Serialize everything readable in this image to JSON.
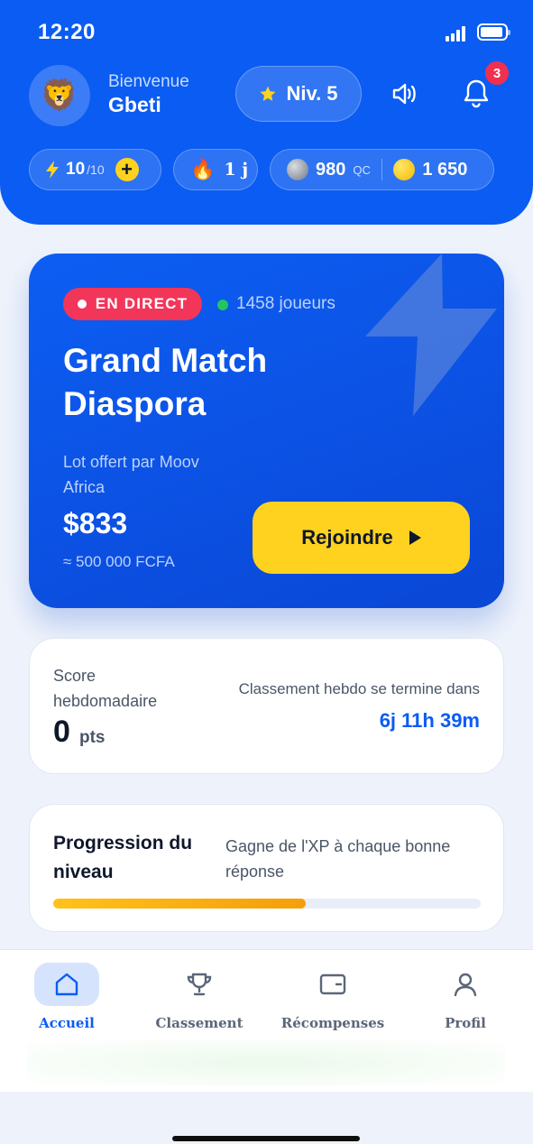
{
  "status_bar": {
    "time": "12:20"
  },
  "header": {
    "welcome": "Bienvenue",
    "username": "Gbeti",
    "avatar_emoji": "🦁",
    "level_label": "Niv. 5",
    "notifications_count": "3",
    "energy": {
      "value": "10",
      "max": "/10"
    },
    "streak": {
      "icon": "🔥",
      "value": "1 j"
    },
    "qc": {
      "value": "980",
      "unit": "QC"
    },
    "coins": {
      "value": "1 650"
    }
  },
  "live_card": {
    "badge": "EN DIRECT",
    "players": "1458  joueurs",
    "title": "Grand Match Diaspora",
    "sponsor": "Lot offert par Moov Africa",
    "prize": "$833",
    "prize_fcfa": "≈ 500 000 FCFA",
    "join_label": "Rejoindre"
  },
  "weekly": {
    "label": "Score hebdomadaire",
    "score": "0",
    "unit": "pts",
    "ends_label": "Classement hebdo se termine dans",
    "ends_value": "6j 11h 39m"
  },
  "progression": {
    "title": "Progression du niveau",
    "subtitle": "Gagne de l'XP à chaque bonne réponse",
    "fraction": 0.59
  },
  "nav": {
    "items": [
      {
        "label": "Accueil",
        "icon": "home-icon",
        "active": true
      },
      {
        "label": "Classement",
        "icon": "trophy-icon",
        "active": false
      },
      {
        "label": "Récompenses",
        "icon": "wallet-icon",
        "active": false
      },
      {
        "label": "Profil",
        "icon": "user-icon",
        "active": false
      }
    ]
  },
  "colors": {
    "primary": "#0b5cf2",
    "accent_yellow": "#ffd21f",
    "live_red": "#f2365a",
    "online_green": "#22c55e"
  }
}
